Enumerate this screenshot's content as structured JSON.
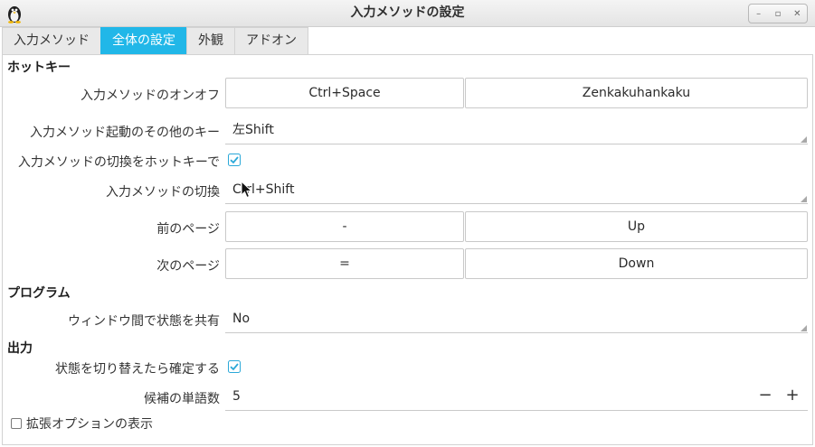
{
  "window": {
    "title": "入力メソッドの設定",
    "buttons": {
      "minimize": "–",
      "maximize": "▫",
      "close": "✕"
    }
  },
  "tabs": [
    {
      "label": "入力メソッド",
      "active": false
    },
    {
      "label": "全体の設定",
      "active": true
    },
    {
      "label": "外観",
      "active": false
    },
    {
      "label": "アドオン",
      "active": false
    }
  ],
  "sections": {
    "hotkey": "ホットキー",
    "program": "プログラム",
    "output": "出力"
  },
  "hotkey": {
    "toggle_label": "入力メソッドのオンオフ",
    "toggle_keys": [
      "Ctrl+Space",
      "Zenkakuhankaku"
    ],
    "extra_activate_label": "入力メソッド起動のその他のキー",
    "extra_activate_value": "左Shift",
    "enable_switch_label": "入力メソッドの切換をホットキーで",
    "enable_switch_checked": true,
    "switch_label": "入力メソッドの切換",
    "switch_value": "Ctrl+Shift",
    "prev_page_label": "前のページ",
    "prev_page_keys": [
      "-",
      "Up"
    ],
    "next_page_label": "次のページ",
    "next_page_keys": [
      "=",
      "Down"
    ]
  },
  "program": {
    "share_state_label": "ウィンドウ間で状態を共有",
    "share_state_value": "No"
  },
  "output": {
    "commit_on_switch_label": "状態を切り替えたら確定する",
    "commit_on_switch_checked": true,
    "candidate_count_label": "候補の単語数",
    "candidate_count_value": "5",
    "decrement": "−",
    "increment": "+"
  },
  "advanced": {
    "label": "拡張オプションの表示",
    "checked": false
  },
  "colors": {
    "accent": "#21b7e8",
    "check": "#2aa8d8"
  }
}
